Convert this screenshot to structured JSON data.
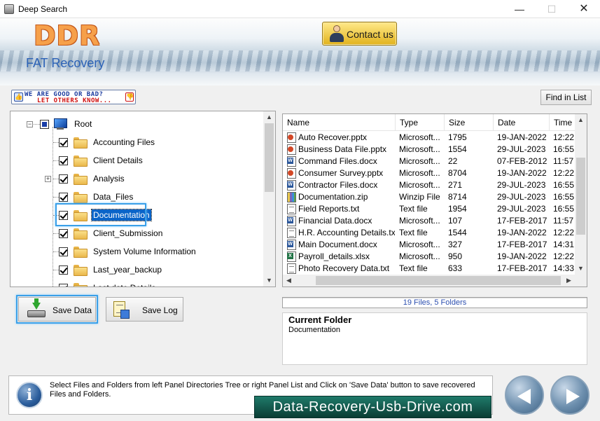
{
  "window": {
    "title": "Deep Search",
    "minimize": "—",
    "maximize": "☐",
    "close": "✕"
  },
  "banner": {
    "logo": "DDR",
    "subtitle": "FAT Recovery",
    "contact_label": "Contact us"
  },
  "feedback": {
    "line1": "WE ARE GOOD OR BAD?",
    "line2": "LET OTHERS KNOW..."
  },
  "find_label": "Find in List",
  "tree": {
    "root": "Root",
    "items": [
      {
        "label": "Accounting Files",
        "checked": true
      },
      {
        "label": "Client Details",
        "checked": true
      },
      {
        "label": "Analysis",
        "checked": true,
        "expandable": true
      },
      {
        "label": "Data_Files",
        "checked": true
      },
      {
        "label": "Documentation",
        "checked": true,
        "selected": true
      },
      {
        "label": "Client_Submission",
        "checked": true
      },
      {
        "label": "System Volume Information",
        "checked": true
      },
      {
        "label": "Last_year_backup",
        "checked": true
      },
      {
        "label": "Last date Details",
        "checked": true
      }
    ]
  },
  "list": {
    "columns": [
      "Name",
      "Type",
      "Size",
      "Date",
      "Time"
    ],
    "rows": [
      {
        "icon": "ppt",
        "name": "Auto Recover.pptx",
        "type": "Microsoft...",
        "size": "1795",
        "date": "19-JAN-2022",
        "time": "12:22"
      },
      {
        "icon": "ppt",
        "name": "Business Data File.pptx",
        "type": "Microsoft...",
        "size": "1554",
        "date": "29-JUL-2023",
        "time": "16:55"
      },
      {
        "icon": "doc",
        "name": "Command Files.docx",
        "type": "Microsoft...",
        "size": "22",
        "date": "07-FEB-2012",
        "time": "11:57"
      },
      {
        "icon": "ppt",
        "name": "Consumer Survey.pptx",
        "type": "Microsoft...",
        "size": "8704",
        "date": "19-JAN-2022",
        "time": "12:22"
      },
      {
        "icon": "doc",
        "name": "Contractor Files.docx",
        "type": "Microsoft...",
        "size": "271",
        "date": "29-JUL-2023",
        "time": "16:55"
      },
      {
        "icon": "zip",
        "name": "Documentation.zip",
        "type": "Winzip File",
        "size": "8714",
        "date": "29-JUL-2023",
        "time": "16:55"
      },
      {
        "icon": "txt",
        "name": "Field Reports.txt",
        "type": "Text file",
        "size": "1954",
        "date": "29-JUL-2023",
        "time": "16:55"
      },
      {
        "icon": "doc",
        "name": "Financial Data.docx",
        "type": "Microsoft...",
        "size": "107",
        "date": "17-FEB-2017",
        "time": "11:57"
      },
      {
        "icon": "txt",
        "name": "H.R. Accounting Details.txt",
        "type": "Text file",
        "size": "1544",
        "date": "19-JAN-2022",
        "time": "12:22"
      },
      {
        "icon": "doc",
        "name": "Main Document.docx",
        "type": "Microsoft...",
        "size": "327",
        "date": "17-FEB-2017",
        "time": "14:31"
      },
      {
        "icon": "xls",
        "name": "Payroll_details.xlsx",
        "type": "Microsoft...",
        "size": "950",
        "date": "19-JAN-2022",
        "time": "12:22"
      },
      {
        "icon": "txt",
        "name": "Photo Recovery Data.txt",
        "type": "Text file",
        "size": "633",
        "date": "17-FEB-2017",
        "time": "14:33"
      }
    ]
  },
  "buttons": {
    "save_data": "Save Data",
    "save_log": "Save Log"
  },
  "status": "19 Files, 5 Folders",
  "current_folder": {
    "heading": "Current Folder",
    "value": "Documentation"
  },
  "footer": {
    "info": "Select Files and Folders from left Panel Directories Tree or right Panel List and Click on 'Save Data' button to save recovered Files and Folders.",
    "brand": "Data-Recovery-Usb-Drive.com"
  },
  "icons": {
    "app": "app-icon",
    "contact": "person-icon",
    "info": "info-icon",
    "back": "back-arrow-icon",
    "next": "next-arrow-icon"
  },
  "colors": {
    "logo": "#f6a04a",
    "subtitle": "#2c62b6",
    "selection": "#0a64c8",
    "highlight": "#3aa0e8",
    "status_text": "#2c4fb0",
    "brand_bg": "#0a3d34"
  }
}
